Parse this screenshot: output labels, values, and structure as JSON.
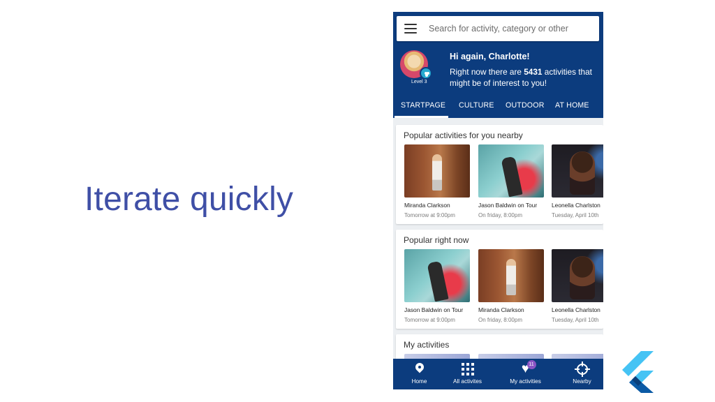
{
  "slide": {
    "title": "Iterate quickly"
  },
  "app": {
    "search": {
      "placeholder": "Search for activity, category or other"
    },
    "profile": {
      "level": "Level 3",
      "greeting": "Hi again, Charlotte!",
      "sub_prefix": "Right now there are ",
      "activity_count": "5431",
      "sub_suffix": " activities that might be of interest to you!"
    },
    "tabs": [
      "STARTPAGE",
      "CULTURE",
      "OUTDOOR",
      "AT HOME"
    ],
    "sections": [
      {
        "title": "Popular activities for you nearby",
        "cards": [
          {
            "name": "Miranda Clarkson",
            "date": "Tomorrow at 9:00pm"
          },
          {
            "name": "Jason Baldwin on Tour",
            "date": "On friday, 8:00pm"
          },
          {
            "name": "Leonella Charlston",
            "date": "Tuesday, April 10th"
          }
        ]
      },
      {
        "title": "Popular right now",
        "cards": [
          {
            "name": "Jason Baldwin on Tour",
            "date": "Tomorrow at 9:00pm"
          },
          {
            "name": "Miranda Clarkson",
            "date": "On friday, 8:00pm"
          },
          {
            "name": "Leonella Charlston",
            "date": "Tuesday, April 10th"
          }
        ]
      },
      {
        "title": "My activities"
      }
    ],
    "bottom_nav": [
      {
        "label": "Home",
        "icon": "location-pin-icon"
      },
      {
        "label": "All activites",
        "icon": "grid-icon"
      },
      {
        "label": "My activities",
        "icon": "heart-icon",
        "badge": "11"
      },
      {
        "label": "Nearby",
        "icon": "crosshair-icon"
      }
    ]
  },
  "colors": {
    "app_primary": "#0c3c7e",
    "title_color": "#3f4fa6",
    "badge": "#8a53c4"
  }
}
